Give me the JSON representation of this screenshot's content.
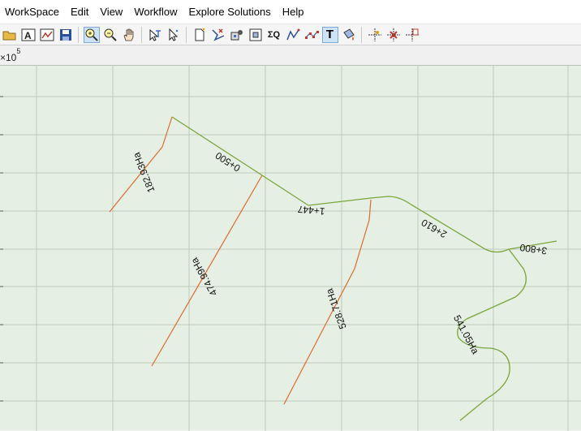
{
  "menu": {
    "items": [
      "WorkSpace",
      "Edit",
      "View",
      "Workflow",
      "Explore Solutions",
      "Help"
    ]
  },
  "toolbar": {
    "buttons": [
      {
        "name": "open-folder-icon"
      },
      {
        "name": "text-import-icon"
      },
      {
        "name": "map-image-icon"
      },
      {
        "name": "save-icon"
      },
      {
        "name": "zoom-in-icon",
        "active": true
      },
      {
        "name": "zoom-out-icon"
      },
      {
        "name": "pan-hand-icon"
      },
      {
        "name": "select-network-icon"
      },
      {
        "name": "select-arrow-icon"
      },
      {
        "name": "new-page-icon"
      },
      {
        "name": "draw-line-icon"
      },
      {
        "name": "node-tools-icon"
      },
      {
        "name": "fit-extent-icon"
      },
      {
        "name": "sum-q-icon"
      },
      {
        "name": "polyline-icon"
      },
      {
        "name": "points-icon"
      },
      {
        "name": "text-tool-icon",
        "active": true
      },
      {
        "name": "paint-bucket-icon"
      },
      {
        "name": "add-node-icon"
      },
      {
        "name": "delete-node-icon"
      },
      {
        "name": "node-properties-icon"
      }
    ],
    "sum_label": "ΣQ",
    "text_label": "T"
  },
  "axis": {
    "exponent_base": "×10",
    "exponent_power": "5"
  },
  "colors": {
    "background": "#e5efe3",
    "gridline": "#b9c4b8",
    "main_channel": "#7aa63c",
    "lateral_channel": "#e0692e"
  },
  "labels": {
    "chainage_0500": "0+500",
    "chainage_1447": "1+447",
    "chainage_2610": "2+610",
    "chainage_3800": "3+800",
    "area_182": "182.93Ha",
    "area_474": "474.99Ha",
    "area_528": "528.71Ha",
    "area_541": "541.05Ha"
  }
}
